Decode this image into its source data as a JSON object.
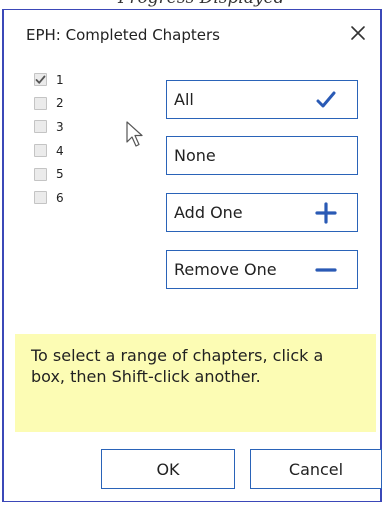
{
  "caption": "Progress Displayed",
  "dialog": {
    "title": "EPH: Completed Chapters",
    "close_glyph": "✕"
  },
  "chapters": [
    {
      "label": "1",
      "checked": true
    },
    {
      "label": "2",
      "checked": false
    },
    {
      "label": "3",
      "checked": false
    },
    {
      "label": "4",
      "checked": false
    },
    {
      "label": "5",
      "checked": false
    },
    {
      "label": "6",
      "checked": false
    }
  ],
  "buttons": {
    "all": {
      "label": "All",
      "icon": "checkmark-icon"
    },
    "none": {
      "label": "None"
    },
    "add_one": {
      "label": "Add One",
      "icon": "plus-icon"
    },
    "remove_one": {
      "label": "Remove One",
      "icon": "minus-icon"
    }
  },
  "hint": {
    "text": "To select a range of chapters, click a box, then Shift-click another."
  },
  "footer": {
    "ok_label": "OK",
    "cancel_label": "Cancel"
  },
  "colors": {
    "accent": "#2a63b8",
    "hint_background": "#fcfcb4",
    "window_border": "#3b48b8"
  }
}
